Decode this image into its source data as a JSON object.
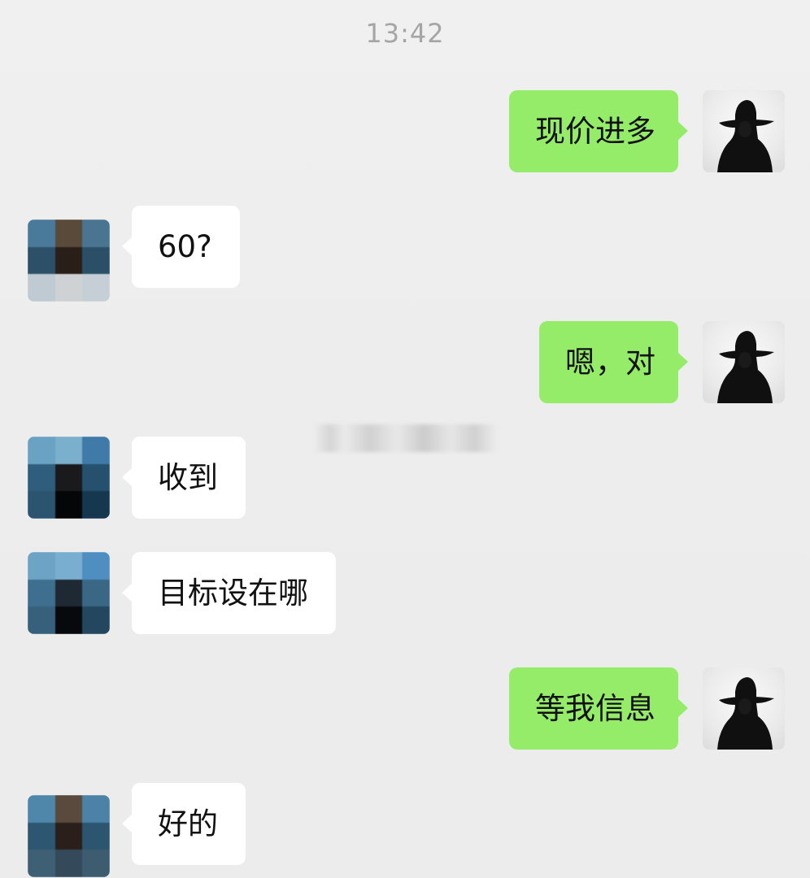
{
  "header": {
    "timestamp": "13:42"
  },
  "messages": [
    {
      "sender": "self",
      "text": "现价进多"
    },
    {
      "sender": "other",
      "text": "60?"
    },
    {
      "sender": "self",
      "text": "嗯，对"
    },
    {
      "sender": "other",
      "text": "收到"
    },
    {
      "sender": "other",
      "text": "目标设在哪"
    },
    {
      "sender": "self",
      "text": "等我信息"
    },
    {
      "sender": "other",
      "text": "好的"
    }
  ],
  "colors": {
    "background": "#ededed",
    "outgoing_bubble": "#95ec69",
    "incoming_bubble": "#ffffff",
    "timestamp_text": "#a5a5a5",
    "message_text": "#111111"
  },
  "icons": {
    "self_avatar": "silhouette-with-hat-avatar",
    "other_avatar": "pixelated-avatar"
  }
}
